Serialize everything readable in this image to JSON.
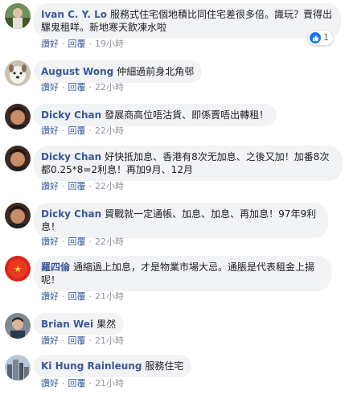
{
  "comments": [
    {
      "author": "Ivan C. Y. Lo",
      "text": "服務式住宅個地積比同住宅差很多倍。識玩？賣得出騾鬼租咩。新地寒天飲凍水啦",
      "like": "讚好",
      "reply": "回覆",
      "time": "19小時",
      "reactions": "1",
      "avatar": "outdoor-photo"
    },
    {
      "author": "August Wong",
      "text": "仲細過前身北角邨",
      "like": "讚好",
      "reply": "回覆",
      "time": "22小時",
      "avatar": "dog-photo"
    },
    {
      "author": "Dicky Chan",
      "text": "發展商高位唔沽貨、即係賣唔出轉租！",
      "like": "讚好",
      "reply": "回覆",
      "time": "22小時",
      "avatar": "person-photo"
    },
    {
      "author": "Dicky Chan",
      "text": "好快抵加息、香港有8次无加息、之後又加！加番8次都0.25*8=2利息！再加9月、12月",
      "like": "讚好",
      "reply": "回覆",
      "time": "22小時",
      "avatar": "person-photo"
    },
    {
      "author": "Dicky Chan",
      "text": "貿戰就一定通帳、加息、加息、再加息！97年9利息！",
      "like": "讚好",
      "reply": "回覆",
      "time": "22小時",
      "avatar": "person-photo"
    },
    {
      "author": "羅四倫",
      "text": "通縮過上加息，才是物業市場大忌。通脹是代表租金上揚呢！",
      "like": "讚好",
      "reply": "回覆",
      "time": "21小時",
      "avatar": "red-flag-photo"
    },
    {
      "author": "Brian Wei",
      "text": "果然",
      "like": "讚好",
      "reply": "回覆",
      "time": "21小時",
      "avatar": "person-photo-2"
    },
    {
      "author": "Ki Hung Rainleung",
      "text": "服務住宅",
      "like": "讚好",
      "reply": "回覆",
      "time": "21小時",
      "avatar": "city-photo"
    }
  ],
  "colors": {
    "author": "#385898",
    "bubble": "#f2f3f5",
    "meta": "#90949c",
    "like_badge": "#1877f2"
  }
}
